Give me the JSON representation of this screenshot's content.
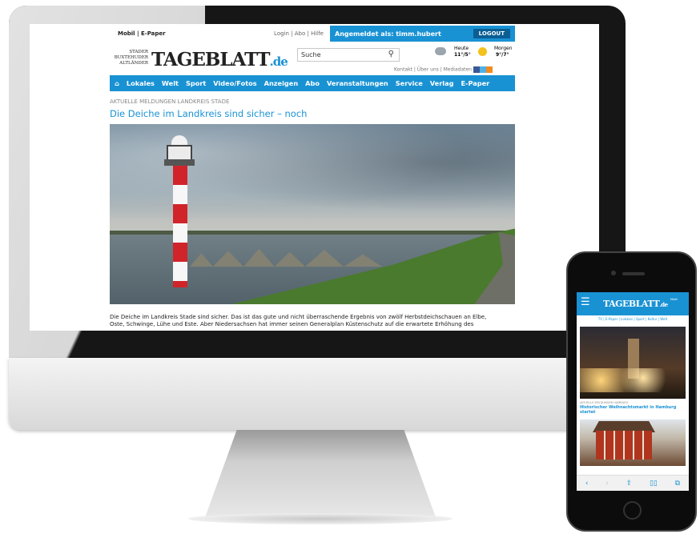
{
  "colors": {
    "accent": "#1992d4",
    "lighthouse_red": "#d0242a",
    "nav_text": "#ffffff"
  },
  "desktop": {
    "topbar": {
      "mobil": "Mobil | E-Paper",
      "login": "Login | Abo | Hilfe",
      "logged_in": "Angemeldet als: timm.hubert",
      "logout": "LOGOUT"
    },
    "brand": {
      "small_line1": "STADER",
      "small_line2": "BUXTEHUDER",
      "small_line3": "ALTLÄNDER",
      "logo": "TAGEBLATT",
      "logo_suffix": ".de"
    },
    "search": {
      "placeholder": "Suche",
      "icon": "search-icon"
    },
    "links": "Kontakt | Über uns | Mediadaten",
    "weather": {
      "today_label": "Heute",
      "today_temp": "11°/5°",
      "tomorrow_label": "Morgen",
      "tomorrow_temp": "9°/7°"
    },
    "nav": {
      "home_icon": "house-icon",
      "items": [
        "Lokales",
        "Welt",
        "Sport",
        "Video/Fotos",
        "Anzeigen",
        "Abo",
        "Veranstaltungen",
        "Service",
        "Verlag",
        "E-Paper"
      ]
    },
    "article": {
      "kicker": "AKTUELLE MELDUNGEN LANDKREIS STADE",
      "headline": "Die Deiche im Landkreis sind sicher – noch",
      "body_line1": "Die Deiche im Landkreis Stade sind sicher. Das ist das gute und nicht überraschende Ergebnis von zwölf Herbstdeichschauen an Elbe,",
      "body_line2": "Oste, Schwinge, Lühe und Este. Aber Niedersachsen hat immer seinen Generalplan Küstenschutz auf die erwartete Erhöhung des"
    }
  },
  "mobile": {
    "menu_icon": "hamburger-menu-icon",
    "logo": "TAGEBLATT",
    "logo_suffix": ".de",
    "badge": "Mobil",
    "links": "TV | E-Paper | Lokales | Sport | Kultur | Welt",
    "article": {
      "kicker": "AKTUELLE MELDUNGEN HAMBURG",
      "title": "Historischer Weihnachtsmarkt in Hamburg startet"
    },
    "toolbar": {
      "back": "‹",
      "forward": "›",
      "share": "⇪",
      "bookmarks": "▯▯",
      "tabs": "⧉"
    }
  }
}
